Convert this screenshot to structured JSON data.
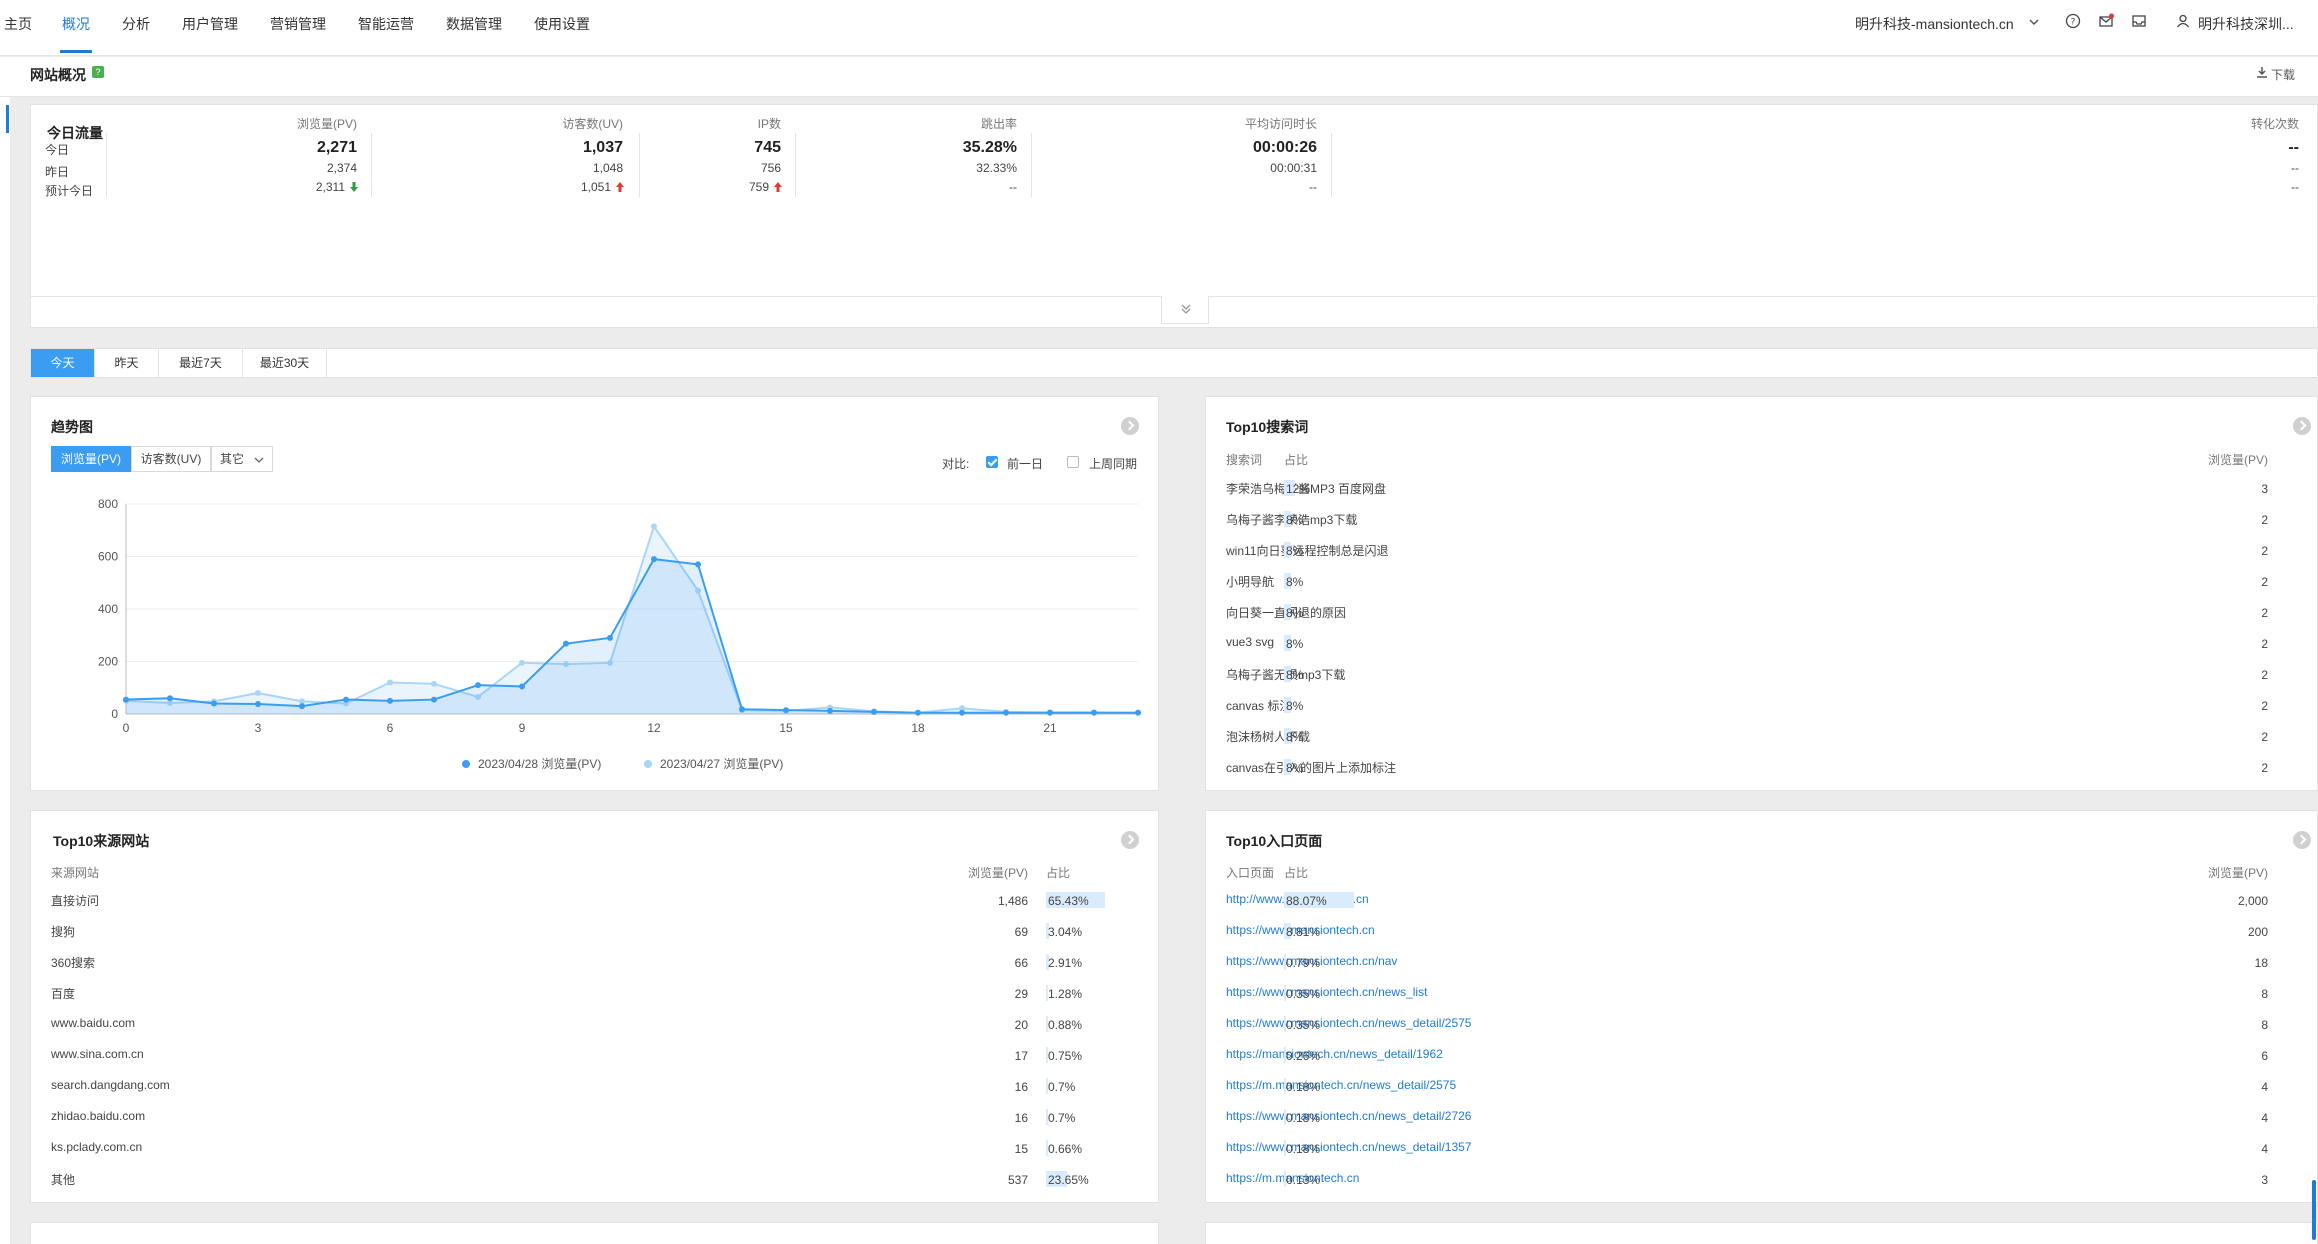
{
  "nav": {
    "items": [
      "主页",
      "概况",
      "分析",
      "用户管理",
      "营销管理",
      "智能运营",
      "数据管理",
      "使用设置"
    ],
    "active_index": 1,
    "site_select": "明升科技-mansiontech.cn",
    "user_name": "明升科技深圳..."
  },
  "subheader": {
    "title": "网站概况",
    "badge": "?",
    "download": "下载"
  },
  "today_traffic": {
    "title": "今日流量",
    "columns": [
      "浏览量(PV)",
      "访客数(UV)",
      "IP数",
      "跳出率",
      "平均访问时长",
      "转化次数"
    ],
    "rows": [
      {
        "label": "今日",
        "values": [
          "2,271",
          "1,037",
          "745",
          "35.28%",
          "00:00:26",
          "--"
        ]
      },
      {
        "label": "昨日",
        "values": [
          "2,374",
          "1,048",
          "756",
          "32.33%",
          "00:00:31",
          "--"
        ]
      },
      {
        "label": "预计今日",
        "values": [
          "2,311",
          "1,051",
          "759",
          "--",
          "--",
          "--"
        ],
        "trends": [
          "down",
          "up",
          "up",
          "",
          "",
          ""
        ]
      }
    ]
  },
  "range_tabs": [
    "今天",
    "昨天",
    "最近7天",
    "最近30天"
  ],
  "trend": {
    "title": "趋势图",
    "metrics": [
      "浏览量(PV)",
      "访客数(UV)",
      "其它"
    ],
    "compare_label": "对比:",
    "compare_options": [
      {
        "label": "前一日",
        "checked": true
      },
      {
        "label": "上周同期",
        "checked": false
      }
    ],
    "legend": [
      "2023/04/28 浏览量(PV)",
      "2023/04/27 浏览量(PV)"
    ],
    "colors": {
      "today": "#3b9df2",
      "yesterday": "#a9d5f7"
    }
  },
  "chart_data": {
    "type": "line",
    "x": [
      0,
      1,
      2,
      3,
      4,
      5,
      6,
      7,
      8,
      9,
      10,
      11,
      12,
      13,
      14,
      15,
      16,
      17,
      18,
      19,
      20,
      21,
      22,
      23
    ],
    "xticks": [
      "0",
      "3",
      "6",
      "9",
      "12",
      "15",
      "18",
      "21"
    ],
    "yticks": [
      "0",
      "200",
      "400",
      "600",
      "800"
    ],
    "ylim": [
      0,
      800
    ],
    "series": [
      {
        "name": "2023/04/28 浏览量(PV)",
        "values": [
          55,
          60,
          40,
          38,
          30,
          55,
          50,
          55,
          110,
          105,
          268,
          290,
          590,
          570,
          18,
          15,
          12,
          8,
          5,
          5,
          5,
          5,
          5,
          5
        ]
      },
      {
        "name": "2023/04/27 浏览量(PV)",
        "values": [
          50,
          42,
          48,
          80,
          48,
          40,
          120,
          115,
          65,
          195,
          190,
          195,
          715,
          470,
          15,
          12,
          25,
          10,
          5,
          22,
          8,
          6,
          6,
          5
        ]
      }
    ]
  },
  "top_search": {
    "title": "Top10搜索词",
    "headers": [
      "搜索词",
      "浏览量(PV)",
      "占比"
    ],
    "rows": [
      {
        "name": "李荣浩乌梅子酱MP3 百度网盘",
        "pv": "3",
        "pct": "12%",
        "frac": 0.12
      },
      {
        "name": "乌梅子酱李荣浩mp3下载",
        "pv": "2",
        "pct": "8%",
        "frac": 0.08
      },
      {
        "name": "win11向日葵远程控制总是闪退",
        "pv": "2",
        "pct": "8%",
        "frac": 0.08
      },
      {
        "name": "小明导航",
        "pv": "2",
        "pct": "8%",
        "frac": 0.08
      },
      {
        "name": "向日葵一直闪退的原因",
        "pv": "2",
        "pct": "8%",
        "frac": 0.08
      },
      {
        "name": "vue3 svg",
        "pv": "2",
        "pct": "8%",
        "frac": 0.08
      },
      {
        "name": "乌梅子酱无损mp3下载",
        "pv": "2",
        "pct": "8%",
        "frac": 0.08
      },
      {
        "name": "canvas 标注",
        "pv": "2",
        "pct": "8%",
        "frac": 0.08
      },
      {
        "name": "泡沫杨树人下载",
        "pv": "2",
        "pct": "8%",
        "frac": 0.08
      },
      {
        "name": "canvas在引入的图片上添加标注",
        "pv": "2",
        "pct": "8%",
        "frac": 0.08
      }
    ]
  },
  "top_source": {
    "title": "Top10来源网站",
    "headers": [
      "来源网站",
      "浏览量(PV)",
      "占比"
    ],
    "rows": [
      {
        "name": "直接访问",
        "pv": "1,486",
        "pct": "65.43%",
        "frac": 0.6543
      },
      {
        "name": "搜狗",
        "pv": "69",
        "pct": "3.04%",
        "frac": 0.0304
      },
      {
        "name": "360搜索",
        "pv": "66",
        "pct": "2.91%",
        "frac": 0.0291
      },
      {
        "name": "百度",
        "pv": "29",
        "pct": "1.28%",
        "frac": 0.0128
      },
      {
        "name": "www.baidu.com",
        "pv": "20",
        "pct": "0.88%",
        "frac": 0.0088
      },
      {
        "name": "www.sina.com.cn",
        "pv": "17",
        "pct": "0.75%",
        "frac": 0.0075
      },
      {
        "name": "search.dangdang.com",
        "pv": "16",
        "pct": "0.7%",
        "frac": 0.007
      },
      {
        "name": "zhidao.baidu.com",
        "pv": "16",
        "pct": "0.7%",
        "frac": 0.007
      },
      {
        "name": "ks.pclady.com.cn",
        "pv": "15",
        "pct": "0.66%",
        "frac": 0.0066
      },
      {
        "name": "其他",
        "pv": "537",
        "pct": "23.65%",
        "frac": 0.2365
      }
    ]
  },
  "top_entry": {
    "title": "Top10入口页面",
    "headers": [
      "入口页面",
      "浏览量(PV)",
      "占比"
    ],
    "rows": [
      {
        "name": "http://www.mansiontech.cn",
        "pv": "2,000",
        "pct": "88.07%",
        "frac": 0.8807
      },
      {
        "name": "https://www.mansiontech.cn",
        "pv": "200",
        "pct": "8.81%",
        "frac": 0.0881
      },
      {
        "name": "https://www.mansiontech.cn/nav",
        "pv": "18",
        "pct": "0.79%",
        "frac": 0.0079
      },
      {
        "name": "https://www.mansiontech.cn/news_list",
        "pv": "8",
        "pct": "0.35%",
        "frac": 0.0035
      },
      {
        "name": "https://www.mansiontech.cn/news_detail/2575",
        "pv": "8",
        "pct": "0.35%",
        "frac": 0.0035
      },
      {
        "name": "https://mansiontech.cn/news_detail/1962",
        "pv": "6",
        "pct": "0.26%",
        "frac": 0.0026
      },
      {
        "name": "https://m.mansiontech.cn/news_detail/2575",
        "pv": "4",
        "pct": "0.18%",
        "frac": 0.0018
      },
      {
        "name": "https://www.mansiontech.cn/news_detail/2726",
        "pv": "4",
        "pct": "0.18%",
        "frac": 0.0018
      },
      {
        "name": "https://www.mansiontech.cn/news_detail/1357",
        "pv": "4",
        "pct": "0.18%",
        "frac": 0.0018
      },
      {
        "name": "https://m.mansiontech.cn",
        "pv": "3",
        "pct": "0.13%",
        "frac": 0.0013
      }
    ]
  }
}
